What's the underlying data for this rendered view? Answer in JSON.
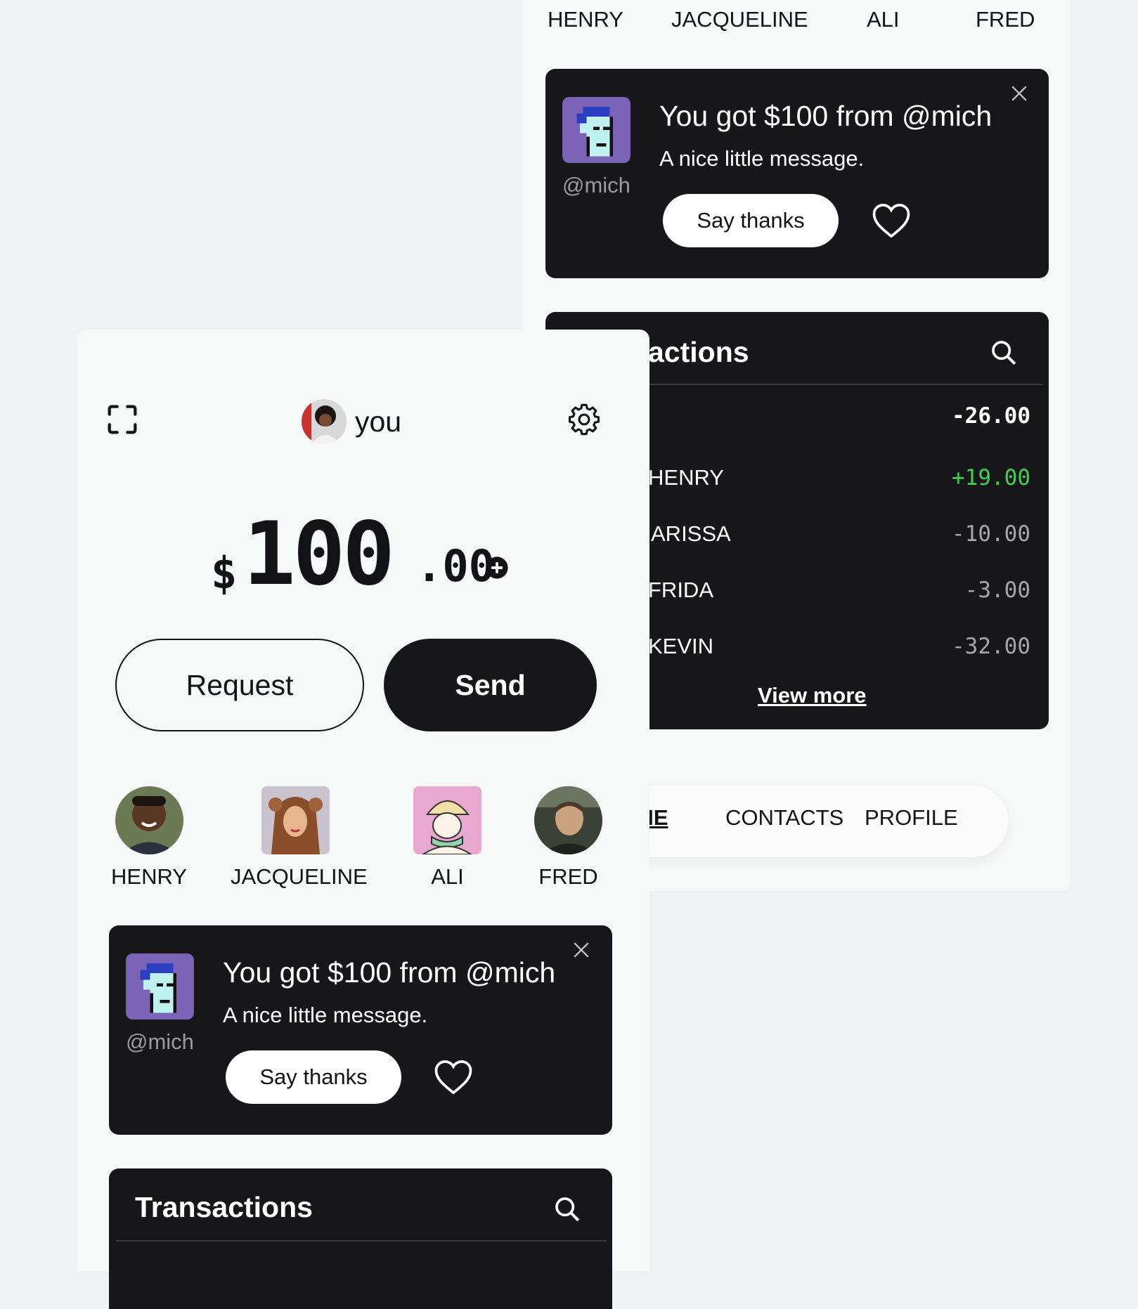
{
  "contacts": [
    {
      "name": "HENRY",
      "avatar": "henry-avatar"
    },
    {
      "name": "JACQUELINE",
      "avatar": "jacqueline-avatar"
    },
    {
      "name": "ALI",
      "avatar": "ali-avatar"
    },
    {
      "name": "FRED",
      "avatar": "fred-avatar"
    }
  ],
  "notification": {
    "title": "You got $100 from @mich",
    "message": "A nice little message.",
    "handle": "@mich",
    "thanks_label": "Say thanks"
  },
  "transactions": {
    "title": "Transactions",
    "title_visible_back": "actions",
    "rows": [
      {
        "name": "",
        "amount": "-26.00",
        "color": "#ffffff"
      },
      {
        "name": "HENRY",
        "name_visible": "HENRY",
        "amount": "+19.00",
        "color": "#39d353"
      },
      {
        "name": "LARISSA",
        "name_visible": "ARISSA",
        "amount": "-10.00",
        "color": "#a6a6ab"
      },
      {
        "name": "FRIDA",
        "name_visible": "FRIDA",
        "amount": "-3.00",
        "color": "#a6a6ab"
      },
      {
        "name": "KEVIN",
        "name_visible": "KEVIN",
        "amount": "-32.00",
        "color": "#a6a6ab"
      }
    ],
    "view_more": "View more"
  },
  "bottom_nav": {
    "home_visible": "ME",
    "contacts": "CONTACTS",
    "profile": "PROFILE"
  },
  "user": {
    "name": "you"
  },
  "balance": {
    "currency": "$",
    "integer": "100",
    "decimals": ".00"
  },
  "actions": {
    "request": "Request",
    "send": "Send"
  },
  "colors": {
    "card_dark": "#17171a",
    "screen_bg": "#f7f8f8",
    "page_bg": "#f0f1f2",
    "positive": "#39d353",
    "muted_amount": "#a6a6ab",
    "avatar_purple": "#7b64b7"
  },
  "icons": {
    "scan": "scan-icon",
    "settings": "gear-icon",
    "add": "plus-circle-icon",
    "search": "search-icon",
    "close": "close-icon",
    "like": "heart-icon"
  }
}
